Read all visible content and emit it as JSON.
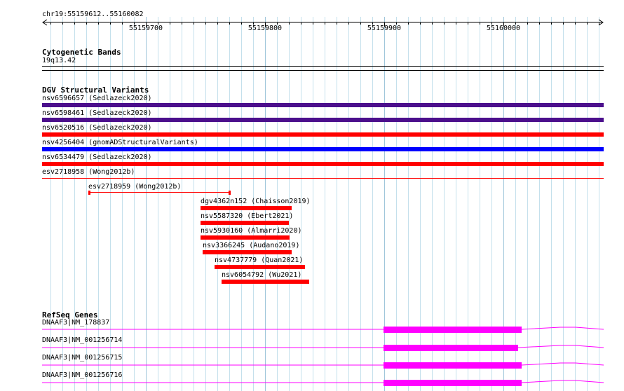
{
  "ruler": {
    "location": "chr19:55159612..55160082",
    "ticks": [
      "55159700",
      "55159800",
      "55159900",
      "55160000"
    ]
  },
  "cytoband": {
    "title": "Cytogenetic Bands",
    "band": "19q13.42"
  },
  "dgv": {
    "title": "DGV Structural Variants",
    "full_width": [
      {
        "label": "nsv6596657 (Sedlazeck2020)",
        "color": "#4b0f8c"
      },
      {
        "label": "nsv6598461 (Sedlazeck2020)",
        "color": "#4b0f8c"
      },
      {
        "label": "nsv6520516 (Sedlazeck2020)",
        "color": "#ff0000"
      },
      {
        "label": "nsv4256404 (gnomADStructuralVariants)",
        "color": "#0000ff"
      },
      {
        "label": "nsv6534479 (Sedlazeck2020)",
        "color": "#ff0000"
      },
      {
        "label": "esv2718958 (Wong2012b)",
        "color": "#ff0000"
      }
    ],
    "partial": [
      {
        "label": "esv2718959 (Wong2012b)",
        "color": "#ff0000"
      },
      {
        "label": "dgv4362n152 (Chaisson2019)",
        "color": "#ff0000"
      },
      {
        "label": "nsv5587320 (Ebert2021)",
        "color": "#ff0000"
      },
      {
        "label": "nsv5930160 (Almarri2020)",
        "color": "#ff0000"
      },
      {
        "label": "nsv3366245 (Audano2019)",
        "color": "#ff0000"
      },
      {
        "label": "nsv4737779 (Quan2021)",
        "color": "#ff0000"
      },
      {
        "label": "nsv6054792 (Wu2021)",
        "color": "#ff0000"
      }
    ]
  },
  "refseq": {
    "title": "RefSeq Genes",
    "color": "#ff00ff",
    "genes": [
      {
        "label": "DNAAF3|NM_178837"
      },
      {
        "label": "DNAAF3|NM_001256714"
      },
      {
        "label": "DNAAF3|NM_001256715"
      },
      {
        "label": "DNAAF3|NM_001256716"
      }
    ]
  }
}
